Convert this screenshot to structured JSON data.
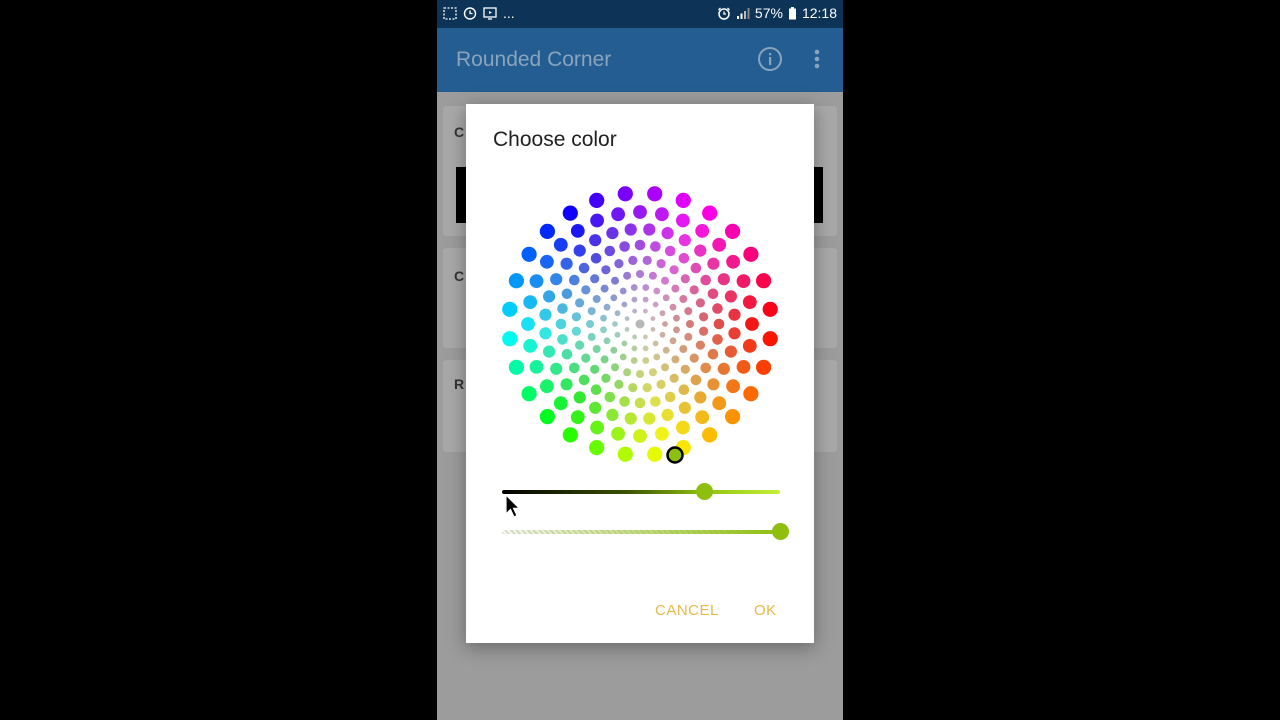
{
  "status_bar": {
    "overflow_dots": "...",
    "battery": "57%",
    "time": "12:18",
    "icons": [
      "screenshot-icon",
      "clock-icon",
      "cast-icon",
      "alarm-icon",
      "signal-icon",
      "battery-icon"
    ]
  },
  "app_bar": {
    "title": "Rounded Corner",
    "icons": [
      "info-icon",
      "overflow-menu-icon"
    ]
  },
  "background_cards": [
    {
      "label": "C"
    },
    {
      "label": "C"
    },
    {
      "label": "R"
    }
  ],
  "dialog": {
    "title": "Choose color",
    "selected_color": "#8fbf0e",
    "lightness_level": 0.73,
    "alpha_level": 1.0,
    "cancel_label": "CANCEL",
    "ok_label": "OK",
    "accent_color": "#e8b84a"
  }
}
